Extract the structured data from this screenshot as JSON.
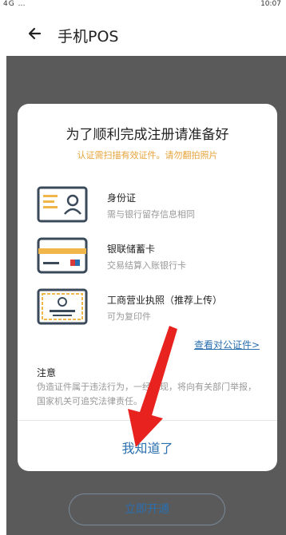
{
  "status_bar": {
    "left": "4G …",
    "right": "10:07"
  },
  "appbar": {
    "title": "手机POS"
  },
  "background": {
    "primary_button": "立即开通"
  },
  "dialog": {
    "title": "为了顺利完成注册请准备好",
    "subtitle": "认证需扫描有效证件。请勿翻拍照片",
    "items": [
      {
        "title": "身份证",
        "desc": "需与银行留存信息相同",
        "icon": "id-card-icon"
      },
      {
        "title": "银联储蓄卡",
        "desc": "交易结算入账银行卡",
        "icon": "bank-card-icon"
      },
      {
        "title": "工商营业执照（推荐上传）",
        "desc": "可为复印件",
        "icon": "business-license-icon"
      }
    ],
    "link": "查看对公证件>",
    "note_title": "注意",
    "note_text": "伪造证件属于违法行为，一经发现，将向有关部门举报，国家机关可追究法律责任。",
    "confirm": "我知道了"
  },
  "colors": {
    "accent": "#2a6fb0",
    "warning": "#e7a33a",
    "overlay": "#5a5a5a",
    "arrow": "#e8231f"
  }
}
